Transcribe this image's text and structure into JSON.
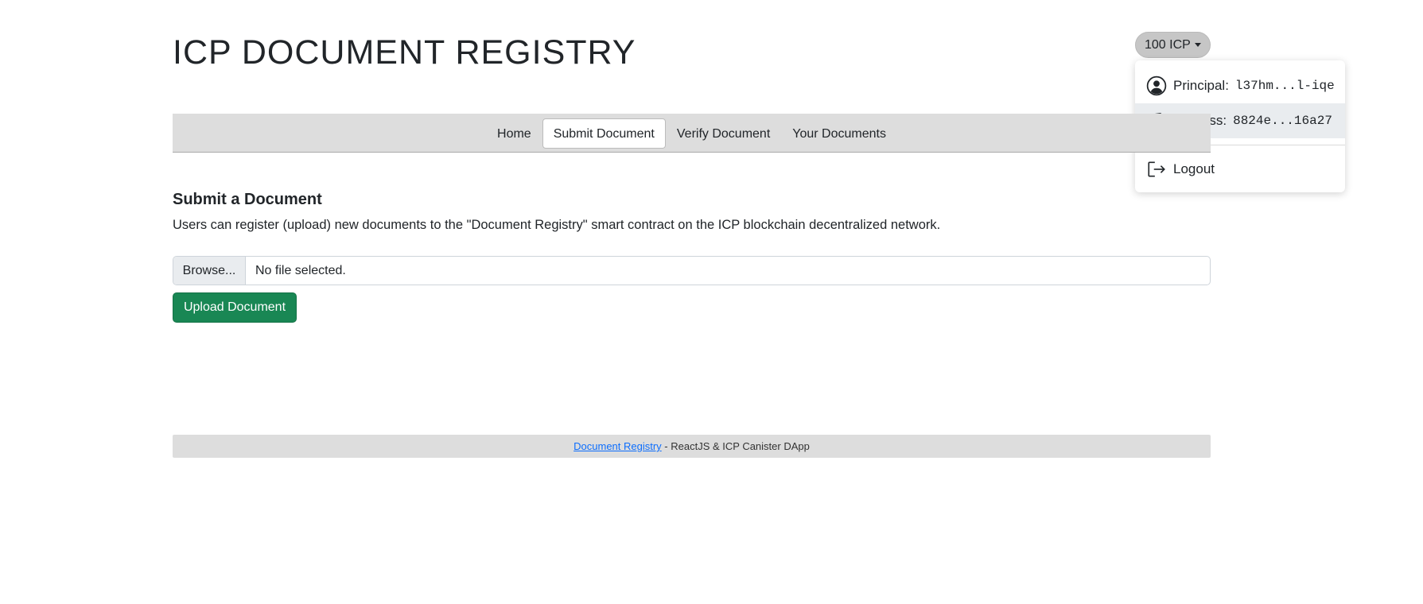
{
  "header": {
    "title": "ICP DOCUMENT REGISTRY"
  },
  "account": {
    "balance_label": "100 ICP",
    "menu": {
      "principal_label": "Principal:",
      "principal_value": "l37hm...l-iqe",
      "address_label": "Address:",
      "address_value": "8824e...16a27",
      "logout_label": "Logout"
    }
  },
  "nav": {
    "tabs": [
      {
        "label": "Home"
      },
      {
        "label": "Submit Document"
      },
      {
        "label": "Verify Document"
      },
      {
        "label": "Your Documents"
      }
    ],
    "active_tab": "Submit Document"
  },
  "main": {
    "title": "Submit a Document",
    "description": "Users can register (upload) new documents to the \"Document Registry\" smart contract on the ICP blockchain decentralized network.",
    "file_input": {
      "browse_label": "Browse...",
      "status": "No file selected."
    },
    "upload_label": "Upload Document"
  },
  "footer": {
    "link_text": "Document Registry",
    "text": " - ReactJS & ICP Canister DApp"
  },
  "colors": {
    "accent_green": "#198754",
    "link_blue": "#0d6efd",
    "nav_bg": "#dddddd"
  },
  "icons": [
    "person-circle-icon",
    "wallet-icon",
    "logout-icon",
    "caret-down-icon"
  ]
}
